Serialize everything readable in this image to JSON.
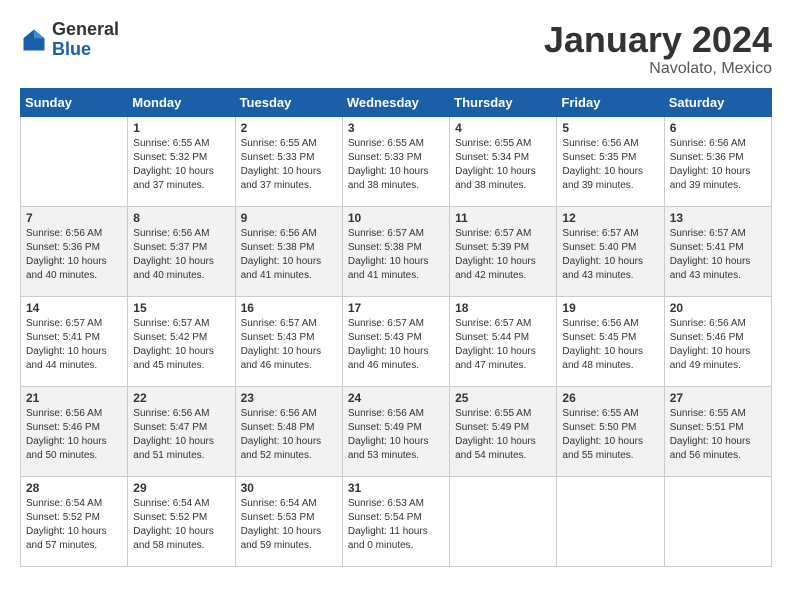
{
  "logo": {
    "general": "General",
    "blue": "Blue"
  },
  "title": "January 2024",
  "location": "Navolato, Mexico",
  "days_of_week": [
    "Sunday",
    "Monday",
    "Tuesday",
    "Wednesday",
    "Thursday",
    "Friday",
    "Saturday"
  ],
  "weeks": [
    [
      {
        "day": "",
        "info": ""
      },
      {
        "day": "1",
        "info": "Sunrise: 6:55 AM\nSunset: 5:32 PM\nDaylight: 10 hours\nand 37 minutes."
      },
      {
        "day": "2",
        "info": "Sunrise: 6:55 AM\nSunset: 5:33 PM\nDaylight: 10 hours\nand 37 minutes."
      },
      {
        "day": "3",
        "info": "Sunrise: 6:55 AM\nSunset: 5:33 PM\nDaylight: 10 hours\nand 38 minutes."
      },
      {
        "day": "4",
        "info": "Sunrise: 6:55 AM\nSunset: 5:34 PM\nDaylight: 10 hours\nand 38 minutes."
      },
      {
        "day": "5",
        "info": "Sunrise: 6:56 AM\nSunset: 5:35 PM\nDaylight: 10 hours\nand 39 minutes."
      },
      {
        "day": "6",
        "info": "Sunrise: 6:56 AM\nSunset: 5:36 PM\nDaylight: 10 hours\nand 39 minutes."
      }
    ],
    [
      {
        "day": "7",
        "info": "Sunrise: 6:56 AM\nSunset: 5:36 PM\nDaylight: 10 hours\nand 40 minutes."
      },
      {
        "day": "8",
        "info": "Sunrise: 6:56 AM\nSunset: 5:37 PM\nDaylight: 10 hours\nand 40 minutes."
      },
      {
        "day": "9",
        "info": "Sunrise: 6:56 AM\nSunset: 5:38 PM\nDaylight: 10 hours\nand 41 minutes."
      },
      {
        "day": "10",
        "info": "Sunrise: 6:57 AM\nSunset: 5:38 PM\nDaylight: 10 hours\nand 41 minutes."
      },
      {
        "day": "11",
        "info": "Sunrise: 6:57 AM\nSunset: 5:39 PM\nDaylight: 10 hours\nand 42 minutes."
      },
      {
        "day": "12",
        "info": "Sunrise: 6:57 AM\nSunset: 5:40 PM\nDaylight: 10 hours\nand 43 minutes."
      },
      {
        "day": "13",
        "info": "Sunrise: 6:57 AM\nSunset: 5:41 PM\nDaylight: 10 hours\nand 43 minutes."
      }
    ],
    [
      {
        "day": "14",
        "info": "Sunrise: 6:57 AM\nSunset: 5:41 PM\nDaylight: 10 hours\nand 44 minutes."
      },
      {
        "day": "15",
        "info": "Sunrise: 6:57 AM\nSunset: 5:42 PM\nDaylight: 10 hours\nand 45 minutes."
      },
      {
        "day": "16",
        "info": "Sunrise: 6:57 AM\nSunset: 5:43 PM\nDaylight: 10 hours\nand 46 minutes."
      },
      {
        "day": "17",
        "info": "Sunrise: 6:57 AM\nSunset: 5:43 PM\nDaylight: 10 hours\nand 46 minutes."
      },
      {
        "day": "18",
        "info": "Sunrise: 6:57 AM\nSunset: 5:44 PM\nDaylight: 10 hours\nand 47 minutes."
      },
      {
        "day": "19",
        "info": "Sunrise: 6:56 AM\nSunset: 5:45 PM\nDaylight: 10 hours\nand 48 minutes."
      },
      {
        "day": "20",
        "info": "Sunrise: 6:56 AM\nSunset: 5:46 PM\nDaylight: 10 hours\nand 49 minutes."
      }
    ],
    [
      {
        "day": "21",
        "info": "Sunrise: 6:56 AM\nSunset: 5:46 PM\nDaylight: 10 hours\nand 50 minutes."
      },
      {
        "day": "22",
        "info": "Sunrise: 6:56 AM\nSunset: 5:47 PM\nDaylight: 10 hours\nand 51 minutes."
      },
      {
        "day": "23",
        "info": "Sunrise: 6:56 AM\nSunset: 5:48 PM\nDaylight: 10 hours\nand 52 minutes."
      },
      {
        "day": "24",
        "info": "Sunrise: 6:56 AM\nSunset: 5:49 PM\nDaylight: 10 hours\nand 53 minutes."
      },
      {
        "day": "25",
        "info": "Sunrise: 6:55 AM\nSunset: 5:49 PM\nDaylight: 10 hours\nand 54 minutes."
      },
      {
        "day": "26",
        "info": "Sunrise: 6:55 AM\nSunset: 5:50 PM\nDaylight: 10 hours\nand 55 minutes."
      },
      {
        "day": "27",
        "info": "Sunrise: 6:55 AM\nSunset: 5:51 PM\nDaylight: 10 hours\nand 56 minutes."
      }
    ],
    [
      {
        "day": "28",
        "info": "Sunrise: 6:54 AM\nSunset: 5:52 PM\nDaylight: 10 hours\nand 57 minutes."
      },
      {
        "day": "29",
        "info": "Sunrise: 6:54 AM\nSunset: 5:52 PM\nDaylight: 10 hours\nand 58 minutes."
      },
      {
        "day": "30",
        "info": "Sunrise: 6:54 AM\nSunset: 5:53 PM\nDaylight: 10 hours\nand 59 minutes."
      },
      {
        "day": "31",
        "info": "Sunrise: 6:53 AM\nSunset: 5:54 PM\nDaylight: 11 hours\nand 0 minutes."
      },
      {
        "day": "",
        "info": ""
      },
      {
        "day": "",
        "info": ""
      },
      {
        "day": "",
        "info": ""
      }
    ]
  ]
}
